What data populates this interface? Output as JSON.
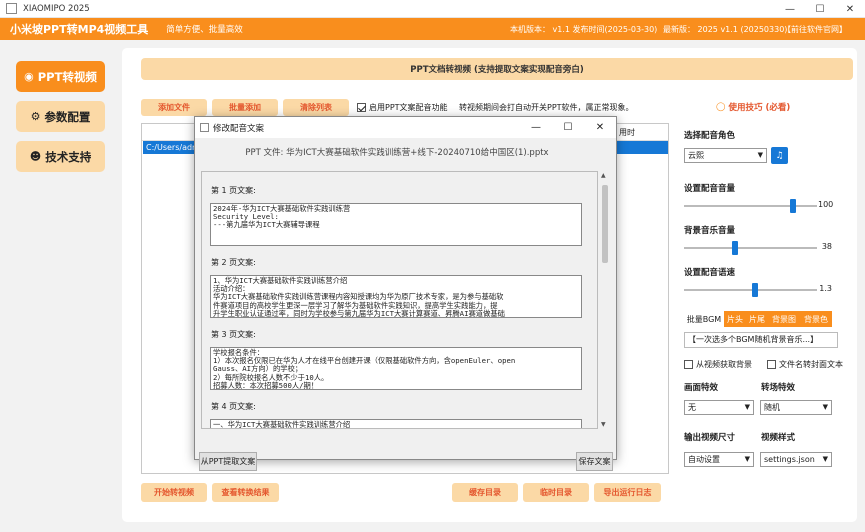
{
  "window": {
    "title": "XIAOMIPO 2025",
    "min": "—",
    "max": "☐",
    "close": "✕"
  },
  "header": {
    "app_name": "小米坡PPT转MP4视频工具",
    "slogan": "简单方便、批量高效",
    "version_info": "本机版本： v1.1   发布时间(2025-03-30)",
    "latest_info": "最新版： 2025 v1.1 (20250330)",
    "official_site": "【前往软件官网】"
  },
  "sidebar": {
    "items": [
      {
        "label": "PPT转视频",
        "icon": "film-icon"
      },
      {
        "label": "参数配置",
        "icon": "gear-icon"
      },
      {
        "label": "技术支持",
        "icon": "user-icon"
      }
    ]
  },
  "banner": "PPT文档转视频 (支持提取文案实现配音旁白)",
  "toolbar": {
    "add_file": "添加文件",
    "batch_add": "批量添加",
    "clear_list": "清除列表",
    "enable_dubbing": "启用PPT文案配音功能",
    "hint": "转视频期间会打自动开关PPT软件，属正常现象。",
    "tips": "使用技巧 (必看)"
  },
  "file_list": {
    "col_time": "用时",
    "row_path": "C:/Users/adm"
  },
  "right_panel": {
    "voice_label": "选择配音角色",
    "voice_value": "云熙",
    "volume_label": "设置配音音量",
    "volume_value": 100,
    "bgm_volume_label": "背景音乐音量",
    "bgm_volume_value": 38,
    "speed_label": "设置配音语速",
    "speed_value": 1.3,
    "bgm_tabs": [
      "批量BGM",
      "片头",
      "片尾",
      "背景图",
      "背景色"
    ],
    "bgm_select": "【一次选多个BGM随机背景音乐...】",
    "from_video_bg": "从视频获取背景",
    "filename_cover": "文件名转封面文本",
    "screen_effect_label": "画面特效",
    "transition_label": "转场特效",
    "screen_effect_value": "无",
    "transition_value": "随机",
    "output_size_label": "输出视频尺寸",
    "video_style_label": "视频样式",
    "output_size_value": "自动设置",
    "video_style_value": "settings.json"
  },
  "bottom": {
    "start": "开始转视频",
    "view_result": "查看转换结果",
    "cache_dir": "缓存目录",
    "temp_dir": "临时目录",
    "export_log": "导出运行日志"
  },
  "dialog": {
    "title": "修改配音文案",
    "file_line": "PPT 文件: 华为ICT大赛基础软件实践训练营+线下-20240710给中国区(1).pptx",
    "pages": [
      {
        "label": "第 1 页文案:",
        "text": "2024年-华为ICT大赛基础软件实践训练营\nSecurity Level:\n---第九届华为ICT大赛辅导课程"
      },
      {
        "label": "第 2 页文案:",
        "text": "1、华为ICT大赛基础软件实践训练营介绍\n活动介绍：\n华为ICT大赛基础软件实践训练营课程内容知授课均为华为原厂技术专家，是为参与基础软\n件赛道项目的高校学生更深一层学习了解华为基础软件实践知识，提高学生实践能力，提\n升学生职业认证通过率，同时为学校参与第九届华为ICT大赛计算赛道、昇腾AI赛道做基础"
      },
      {
        "label": "第 3 页文案:",
        "text": "学校报名条件：\n1）本次报名仅限已在华为人才在线平台创建开课（仅限基础软件方向，含openEuler、open\nGauss、AI方向）的学校；\n2）每所院校报名人数不少于10人。\n招募人数：本次招募500人/期！"
      },
      {
        "label": "第 4 页文案:",
        "text": "一、华为ICT大赛基础软件实践训练营介绍"
      }
    ],
    "extract_btn": "从PPT提取文案",
    "save_btn": "保存文案"
  }
}
